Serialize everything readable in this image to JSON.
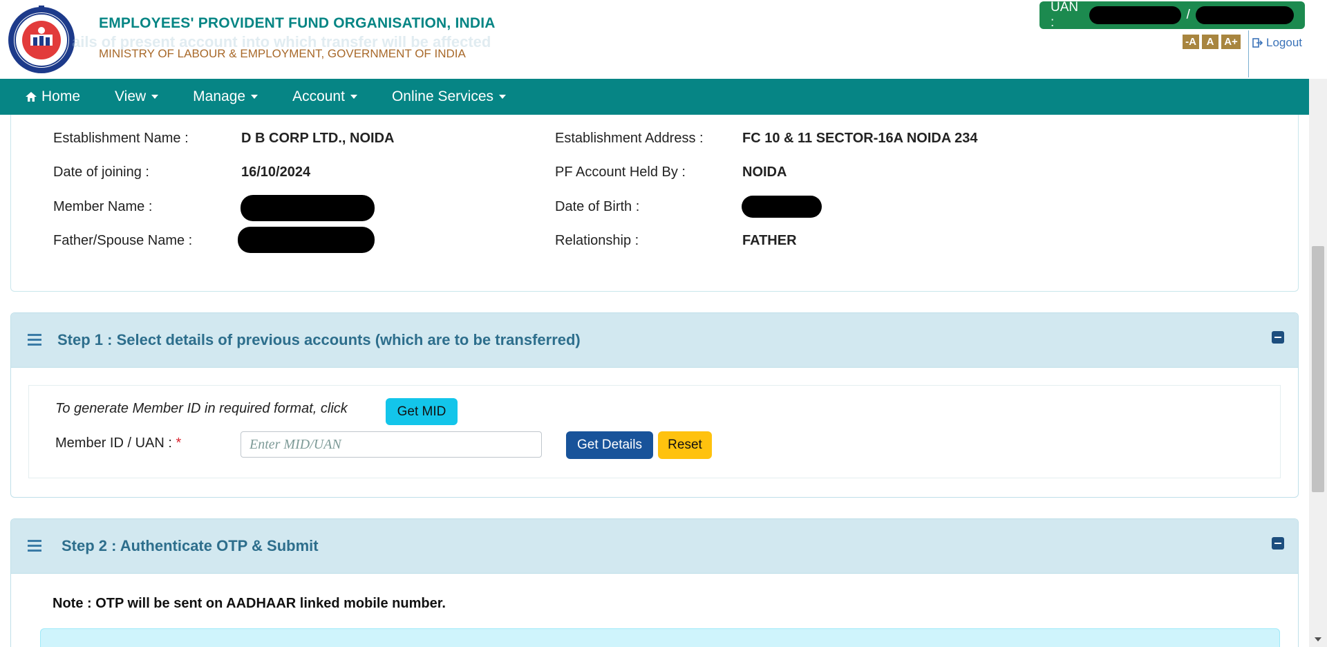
{
  "header": {
    "org_title": "EMPLOYEES' PROVIDENT FUND ORGANISATION, INDIA",
    "ministry": "MINISTRY OF LABOUR & EMPLOYMENT, GOVERNMENT OF INDIA",
    "behind_text": "ails of present account into which transfer will be affected",
    "uan_label": "UAN :",
    "uan_separator": "/",
    "font_buttons": [
      "-A",
      "A",
      "A+"
    ],
    "logout_label": "Logout"
  },
  "nav": {
    "home": "Home",
    "view": "View",
    "manage": "Manage",
    "account": "Account",
    "online_services": "Online Services"
  },
  "details": {
    "establishment_name_label": "Establishment Name :",
    "establishment_name": "D B CORP LTD., NOIDA",
    "establishment_address_label": "Establishment Address :",
    "establishment_address": "FC 10 & 11 SECTOR-16A NOIDA 234",
    "date_of_joining_label": "Date of joining :",
    "date_of_joining": "16/10/2024",
    "pf_account_held_by_label": "PF Account Held By :",
    "pf_account_held_by": "NOIDA",
    "member_name_label": "Member Name :",
    "date_of_birth_label": "Date of Birth :",
    "father_spouse_label": "Father/Spouse Name :",
    "relationship_label": "Relationship :",
    "relationship": "FATHER"
  },
  "step1": {
    "title": "Step 1 : Select details of previous accounts (which are to be transferred)",
    "mid_note": "To generate Member ID in required format, click",
    "get_mid": "Get MID",
    "member_id_label": "Member ID / UAN :",
    "required_mark": "*",
    "input_placeholder": "Enter MID/UAN",
    "get_details": "Get Details",
    "reset": "Reset"
  },
  "step2": {
    "title": "Step 2 : Authenticate OTP & Submit",
    "note": "Note : OTP will be sent on AADHAAR linked mobile number."
  },
  "colors": {
    "teal_nav": "#068585",
    "uan_green": "#1c8a4f",
    "step_header": "#d2e8f0",
    "btn_info": "#13c5ea",
    "btn_primary": "#18539a",
    "btn_warning": "#ffc20e"
  }
}
